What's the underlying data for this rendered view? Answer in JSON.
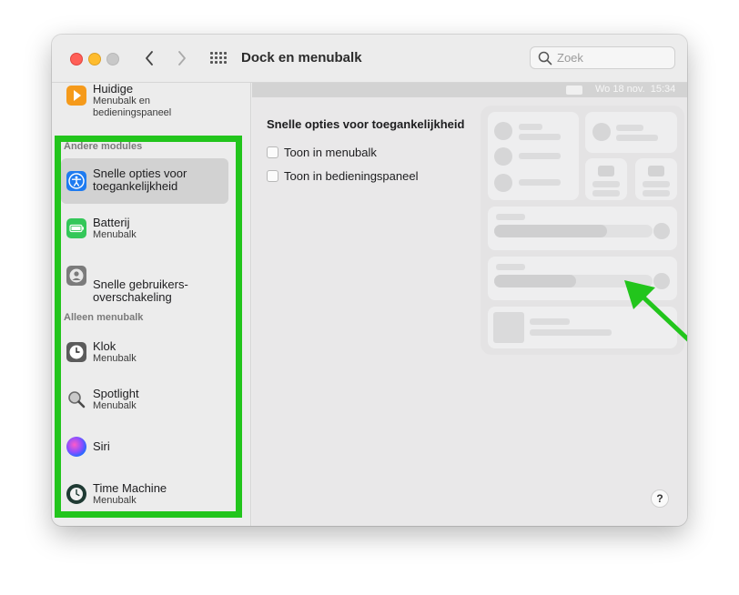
{
  "window": {
    "title": "Dock en menubalk"
  },
  "search": {
    "placeholder": "Zoek"
  },
  "sidebar": {
    "items": [
      {
        "label": "Huidige",
        "sub": "Menubalk en\nbedieningspaneel"
      },
      {
        "label": "Snelle opties voor toegankelijkheid",
        "sub": ""
      },
      {
        "label": "Batterij",
        "sub": "Menubalk"
      },
      {
        "label": "Snelle gebruikers-\noverschakeling",
        "sub": ""
      },
      {
        "label": "Klok",
        "sub": "Menubalk"
      },
      {
        "label": "Spotlight",
        "sub": "Menubalk"
      },
      {
        "label": "Siri",
        "sub": ""
      },
      {
        "label": "Time Machine",
        "sub": "Menubalk"
      }
    ],
    "sections": {
      "other": "Andere modules",
      "menubar_only": "Alleen menubalk"
    }
  },
  "main": {
    "menubar_clock": "Wo 18 nov.  15:34",
    "section_title": "Snelle opties voor toegankelijkheid",
    "options": [
      {
        "label": "Toon in menubalk",
        "checked": false
      },
      {
        "label": "Toon in bedieningspaneel",
        "checked": false
      }
    ],
    "help": "?"
  },
  "colors": {
    "highlight": "#22c51c",
    "arrow": "#22c51c"
  },
  "icons": [
    "play-icon",
    "accessibility-icon",
    "battery-icon",
    "user-switch-icon",
    "clock-icon",
    "spotlight-icon",
    "siri-icon",
    "time-machine-icon"
  ]
}
